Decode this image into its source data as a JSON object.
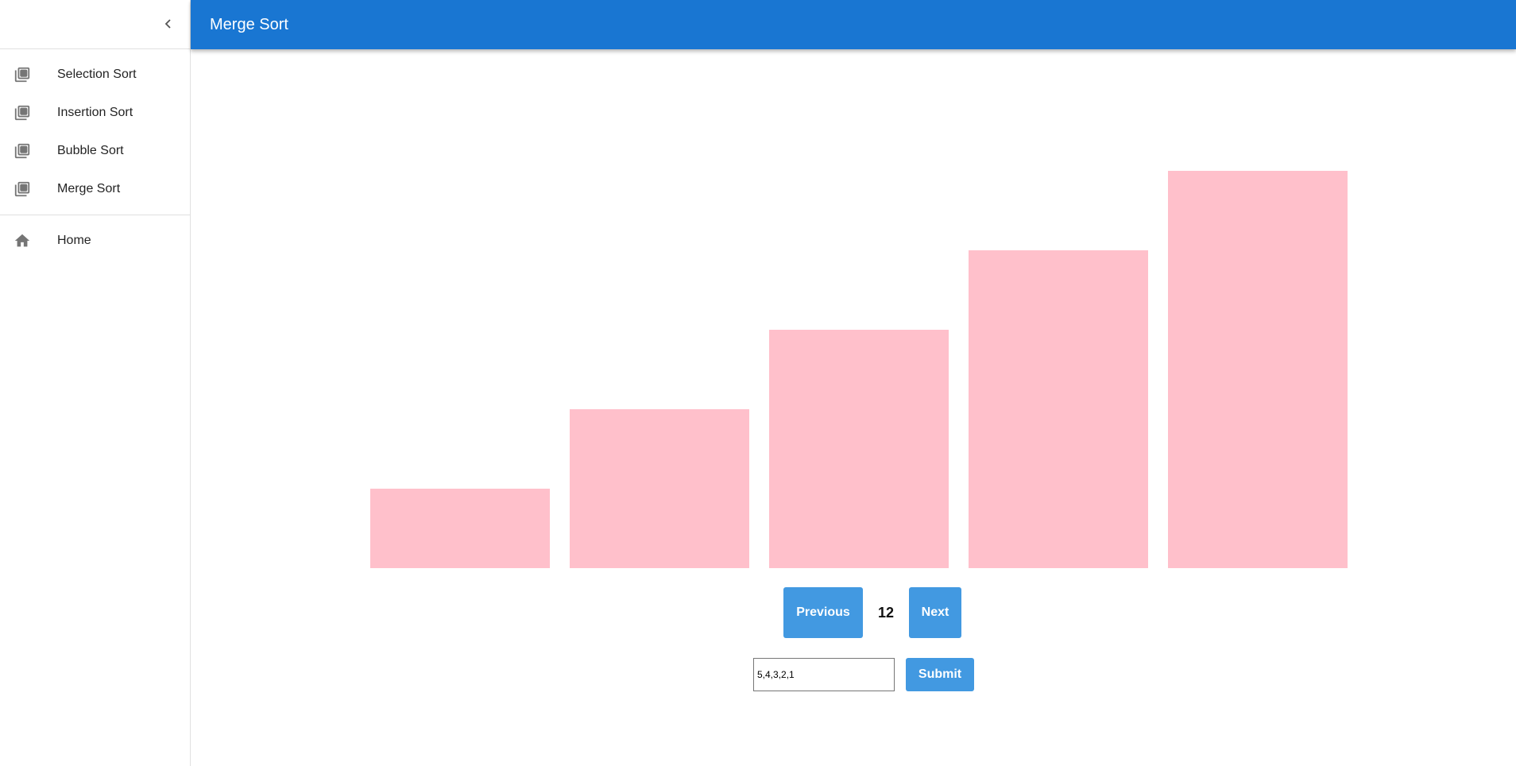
{
  "app": {
    "title": "Merge Sort"
  },
  "sidebar": {
    "collapse_icon": "chevron-left-icon",
    "items": [
      {
        "label": "Selection Sort",
        "icon": "library-books-icon"
      },
      {
        "label": "Insertion Sort",
        "icon": "library-books-icon"
      },
      {
        "label": "Bubble Sort",
        "icon": "library-books-icon"
      },
      {
        "label": "Merge Sort",
        "icon": "library-books-icon"
      }
    ],
    "home": {
      "label": "Home",
      "icon": "home-icon"
    }
  },
  "chart_data": {
    "type": "bar",
    "values": [
      1,
      2,
      3,
      4,
      5
    ],
    "color": "#ffc0cb"
  },
  "controls": {
    "previous_label": "Previous",
    "step": "12",
    "next_label": "Next",
    "input_value": "5,4,3,2,1",
    "submit_label": "Submit"
  },
  "colors": {
    "appbar": "#1976d2",
    "button": "#4299e1",
    "bar": "#ffc0cb"
  }
}
